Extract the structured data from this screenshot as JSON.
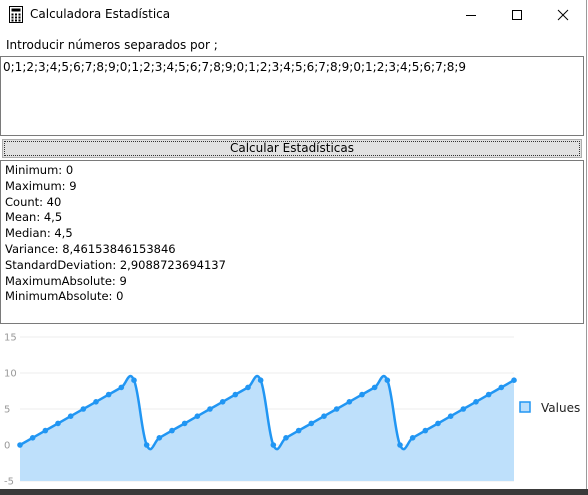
{
  "window": {
    "title": "Calculadora Estadística",
    "icon": "calculator-icon",
    "controls": [
      "minimize-icon",
      "maximize-icon",
      "close-icon"
    ]
  },
  "input": {
    "prompt": "Introducir números separados por ;",
    "value": "0;1;2;3;4;5;6;7;8;9;0;1;2;3;4;5;6;7;8;9;0;1;2;3;4;5;6;7;8;9;0;1;2;3;4;5;6;7;8;9"
  },
  "calculate_button": "Calcular Estadísticas",
  "stats": [
    "Minimum: 0",
    "Maximum: 9",
    "Count: 40",
    "Mean: 4,5",
    "Median: 4,5",
    "Variance: 8,46153846153846",
    "StandardDeviation: 2,9088723694137",
    "MaximumAbsolute: 9",
    "MinimumAbsolute: 0"
  ],
  "chart_data": {
    "type": "area",
    "series": [
      {
        "name": "Values",
        "values": [
          0,
          1,
          2,
          3,
          4,
          5,
          6,
          7,
          8,
          9,
          0,
          1,
          2,
          3,
          4,
          5,
          6,
          7,
          8,
          9,
          0,
          1,
          2,
          3,
          4,
          5,
          6,
          7,
          8,
          9,
          0,
          1,
          2,
          3,
          4,
          5,
          6,
          7,
          8,
          9
        ]
      }
    ],
    "y_ticks": [
      "15",
      "10",
      "5",
      "0",
      "-5"
    ],
    "ylim": [
      -5,
      15
    ],
    "legend_position": "right",
    "colors": {
      "line": "#2196f3",
      "fill": "#bbdefb",
      "point": "#2196f3"
    }
  }
}
